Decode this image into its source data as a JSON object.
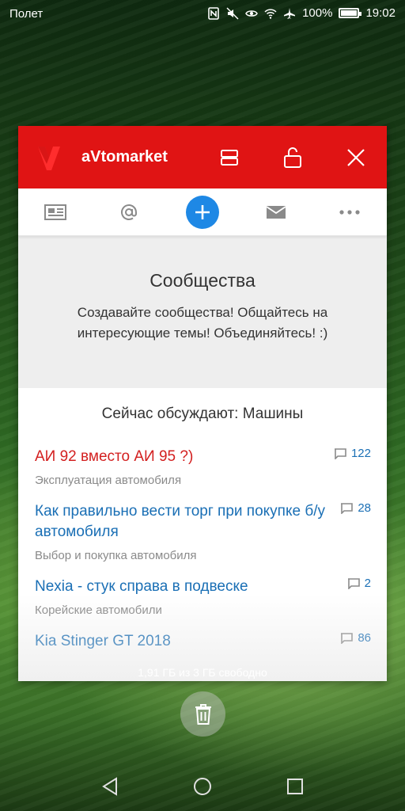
{
  "status_bar": {
    "carrier": "Полет",
    "battery": "100%",
    "battery_level": 1.0,
    "time": "19:02",
    "icons": [
      "nfc-icon",
      "mute-icon",
      "eye-icon",
      "wifi-icon",
      "airplane-icon",
      "battery-icon"
    ]
  },
  "app": {
    "title": "aVtomarket",
    "brand_color": "#e01414",
    "header_icons": [
      "split-screen-icon",
      "unlock-icon",
      "close-icon"
    ]
  },
  "toolbar": {
    "items": [
      "news-icon",
      "at-icon",
      "plus-icon",
      "mail-icon",
      "more-icon"
    ],
    "accent": "#1e88e5"
  },
  "promo": {
    "title": "Сообщества",
    "text": "Создавайте сообщества! Общайтесь на интересующие темы! Объединяйтесь! :)"
  },
  "discussions": {
    "title": "Сейчас обсуждают: Машины",
    "topics": [
      {
        "title": "АИ 92 вместо АИ 95 ?)",
        "category": "Эксплуатация автомобиля",
        "count": "122"
      },
      {
        "title": "Как правильно вести торг при покупке б/у автомобиля",
        "category": "Выбор и покупка автомобиля",
        "count": "28"
      },
      {
        "title": "Nexia - стук справа в подвеске",
        "category": "Корейские автомобили",
        "count": "2"
      },
      {
        "title": "Kia Stinger GT 2018",
        "category": "",
        "count": "86"
      }
    ]
  },
  "storage_text": "1,91 ГБ из 3 ГБ свободно",
  "nav": [
    "back-icon",
    "home-icon",
    "recents-icon"
  ]
}
